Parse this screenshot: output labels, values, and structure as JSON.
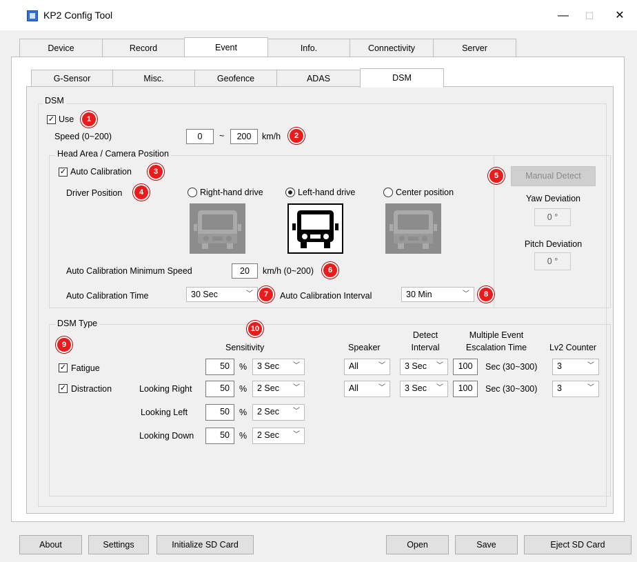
{
  "window": {
    "title": "KP2 Config Tool",
    "minimize": "—",
    "maximize": "☐",
    "close": "✕",
    "icon": "app-icon"
  },
  "tabs": [
    "Device",
    "Record",
    "Event",
    "Info.",
    "Connectivity",
    "Server"
  ],
  "active_tab": "Event",
  "subtabs": [
    "G-Sensor",
    "Misc.",
    "Geofence",
    "ADAS",
    "DSM"
  ],
  "active_subtab": "DSM",
  "dsm": {
    "group_label": "DSM",
    "use_label": "Use",
    "use_checked": true,
    "speed_label": "Speed (0~200)",
    "speed_min": "0",
    "speed_sep": "~",
    "speed_max": "200",
    "speed_unit": "km/h"
  },
  "head_area": {
    "group_label": "Head Area / Camera Position",
    "auto_cal_label": "Auto Calibration",
    "auto_cal_checked": true,
    "driver_position_label": "Driver Position",
    "positions": [
      "Right-hand drive",
      "Left-hand drive",
      "Center position"
    ],
    "selected_position": "Left-hand drive",
    "min_speed_label": "Auto Calibration Minimum Speed",
    "min_speed_value": "20",
    "min_speed_unit": "km/h (0~200)",
    "cal_time_label": "Auto Calibration Time",
    "cal_time_value": "30 Sec",
    "cal_interval_label": "Auto Calibration Interval",
    "cal_interval_value": "30 Min",
    "manual_detect": "Manual Detect",
    "yaw_label": "Yaw Deviation",
    "yaw_value": "0 °",
    "pitch_label": "Pitch Deviation",
    "pitch_value": "0 °"
  },
  "dsm_type": {
    "group_label": "DSM Type",
    "sensitivity_label": "Sensitivity",
    "speaker_label": "Speaker",
    "detect_interval_label_1": "Detect",
    "detect_interval_label_2": "Interval",
    "escalation_label_1": "Multiple Event",
    "escalation_label_2": "Escalation Time",
    "lv2_label": "Lv2 Counter",
    "fatigue": {
      "label": "Fatigue",
      "checked": true,
      "sens": "50",
      "pct": "%",
      "time": "3 Sec",
      "speaker": "All",
      "interval": "3 Sec",
      "esc": "100",
      "esc_unit": "Sec (30~300)",
      "lv2": "3"
    },
    "distraction": {
      "label": "Distraction",
      "checked": true,
      "speaker": "All",
      "interval": "3 Sec",
      "esc": "100",
      "esc_unit": "Sec (30~300)",
      "lv2": "3"
    },
    "looking": [
      {
        "label": "Looking Right",
        "sens": "50",
        "pct": "%",
        "time": "2 Sec"
      },
      {
        "label": "Looking Left",
        "sens": "50",
        "pct": "%",
        "time": "2 Sec"
      },
      {
        "label": "Looking Down",
        "sens": "50",
        "pct": "%",
        "time": "2 Sec"
      }
    ]
  },
  "badges": [
    "1",
    "2",
    "3",
    "4",
    "5",
    "6",
    "7",
    "8",
    "9",
    "10"
  ],
  "footer": {
    "about": "About",
    "settings": "Settings",
    "init_sd": "Initialize SD Card",
    "open": "Open",
    "save": "Save",
    "eject": "Eject SD Card"
  },
  "colors": {
    "badge": "#e81c1c",
    "bus_gray": "#8c8c8c"
  }
}
